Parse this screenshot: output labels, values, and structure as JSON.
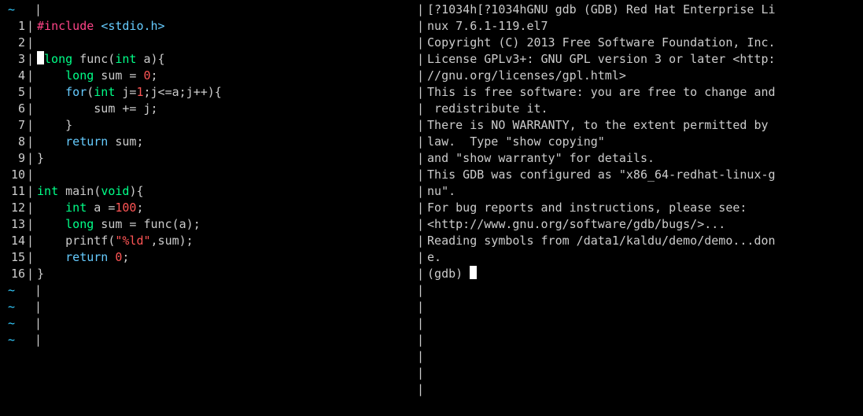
{
  "left": {
    "tilde_top": "~",
    "lines": [
      {
        "num": "1",
        "tokens": [
          [
            "c-pink",
            "#include"
          ],
          [
            "c-white",
            " "
          ],
          [
            "c-blue",
            "<stdio.h>"
          ]
        ]
      },
      {
        "num": "2",
        "tokens": []
      },
      {
        "num": "3",
        "cursor": true,
        "tokens": [
          [
            "c-green",
            "long"
          ],
          [
            "c-white",
            " func("
          ],
          [
            "c-green",
            "int"
          ],
          [
            "c-white",
            " a){"
          ]
        ]
      },
      {
        "num": "4",
        "tokens": [
          [
            "c-white",
            "    "
          ],
          [
            "c-green",
            "long"
          ],
          [
            "c-white",
            " sum = "
          ],
          [
            "c-red",
            "0"
          ],
          [
            "c-white",
            ";"
          ]
        ]
      },
      {
        "num": "5",
        "tokens": [
          [
            "c-white",
            "    "
          ],
          [
            "c-blue",
            "for"
          ],
          [
            "c-white",
            "("
          ],
          [
            "c-green",
            "int"
          ],
          [
            "c-white",
            " j="
          ],
          [
            "c-red",
            "1"
          ],
          [
            "c-white",
            ";j<=a;j++){"
          ]
        ]
      },
      {
        "num": "6",
        "tokens": [
          [
            "c-white",
            "        sum += j;"
          ]
        ]
      },
      {
        "num": "7",
        "tokens": [
          [
            "c-white",
            "    }"
          ]
        ]
      },
      {
        "num": "8",
        "tokens": [
          [
            "c-white",
            "    "
          ],
          [
            "c-blue",
            "return"
          ],
          [
            "c-white",
            " sum;"
          ]
        ]
      },
      {
        "num": "9",
        "tokens": [
          [
            "c-white",
            "}"
          ]
        ]
      },
      {
        "num": "10",
        "tokens": []
      },
      {
        "num": "11",
        "tokens": [
          [
            "c-green",
            "int"
          ],
          [
            "c-white",
            " main("
          ],
          [
            "c-green",
            "void"
          ],
          [
            "c-white",
            "){"
          ]
        ]
      },
      {
        "num": "12",
        "tokens": [
          [
            "c-white",
            "    "
          ],
          [
            "c-green",
            "int"
          ],
          [
            "c-white",
            " a ="
          ],
          [
            "c-red",
            "100"
          ],
          [
            "c-white",
            ";"
          ]
        ]
      },
      {
        "num": "13",
        "tokens": [
          [
            "c-white",
            "    "
          ],
          [
            "c-green",
            "long"
          ],
          [
            "c-white",
            " sum = func(a);"
          ]
        ]
      },
      {
        "num": "14",
        "tokens": [
          [
            "c-white",
            "    printf("
          ],
          [
            "c-red",
            "\"%ld\""
          ],
          [
            "c-white",
            ",sum);"
          ]
        ]
      },
      {
        "num": "15",
        "tokens": [
          [
            "c-white",
            "    "
          ],
          [
            "c-blue",
            "return"
          ],
          [
            "c-white",
            " "
          ],
          [
            "c-red",
            "0"
          ],
          [
            "c-white",
            ";"
          ]
        ]
      },
      {
        "num": "16",
        "tokens": [
          [
            "c-white",
            "}"
          ]
        ]
      }
    ],
    "tildes_bottom": [
      "~",
      "~",
      "~",
      "~"
    ]
  },
  "right": {
    "lines": [
      "[?1034h[?1034hGNU gdb (GDB) Red Hat Enterprise Li",
      "nux 7.6.1-119.el7",
      "Copyright (C) 2013 Free Software Foundation, Inc.",
      "License GPLv3+: GNU GPL version 3 or later <http:",
      "//gnu.org/licenses/gpl.html>",
      "This is free software: you are free to change and",
      " redistribute it.",
      "There is NO WARRANTY, to the extent permitted by ",
      "law.  Type \"show copying\"",
      "and \"show warranty\" for details.",
      "This GDB was configured as \"x86_64-redhat-linux-g",
      "nu\".",
      "For bug reports and instructions, please see:",
      "<http://www.gnu.org/software/gdb/bugs/>...",
      "Reading symbols from /data1/kaldu/demo/demo...don",
      "e."
    ],
    "prompt": "(gdb) "
  }
}
